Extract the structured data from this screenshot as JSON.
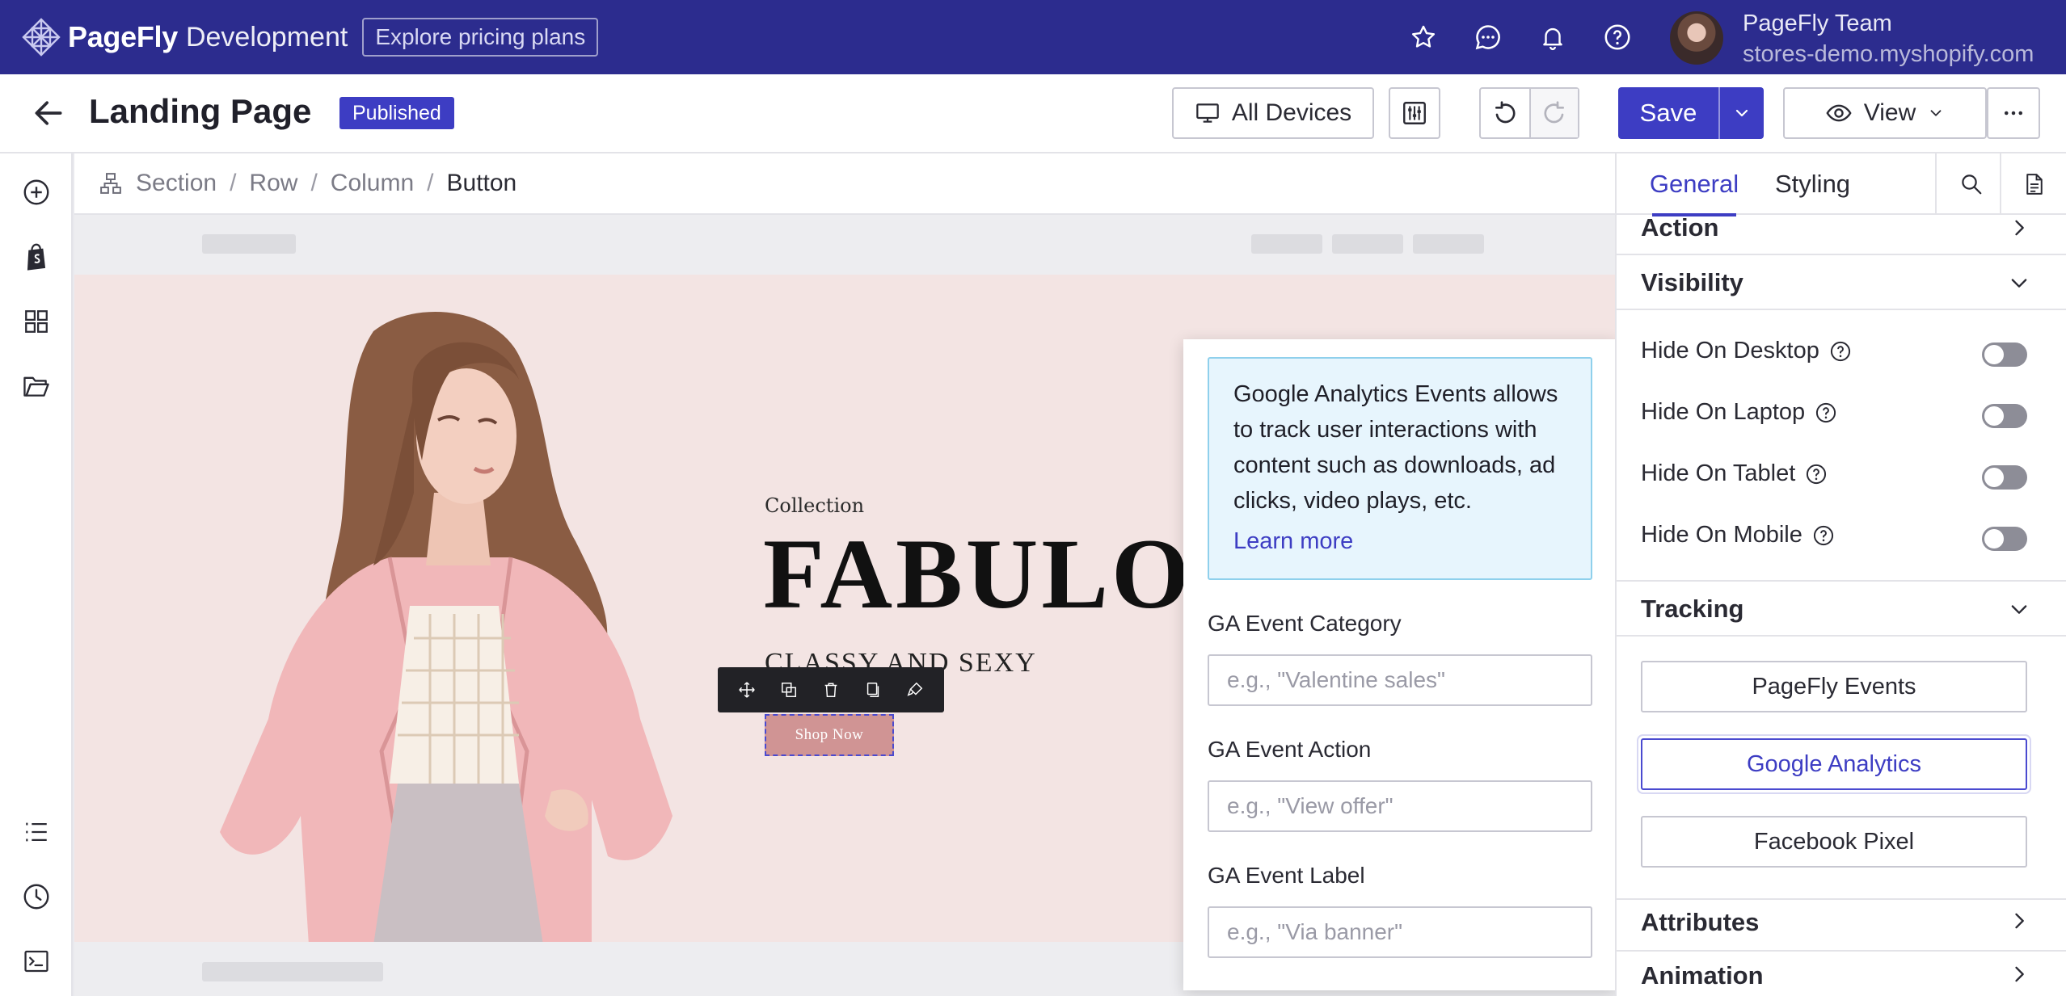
{
  "topbar": {
    "brand": "PageFly",
    "brand_sub": "Development",
    "pricing_label": "Explore pricing plans",
    "user_name": "PageFly Team",
    "user_store": "stores-demo.myshopify.com"
  },
  "page": {
    "title": "Landing Page",
    "status": "Published"
  },
  "toolbar": {
    "devices_label": "All Devices",
    "save_label": "Save",
    "view_label": "View"
  },
  "breadcrumb": [
    "Section",
    "Row",
    "Column",
    "Button"
  ],
  "canvas": {
    "collection": "Collection",
    "headline": "FABULO",
    "tagline": "CLASSY AND SEXY",
    "cta": "Shop Now"
  },
  "popup": {
    "info_text": "Google Analytics Events allows to track user interactions with content such as downloads, ad clicks, video plays, etc.",
    "learn_more": "Learn more",
    "fields": [
      {
        "label": "GA Event Category",
        "placeholder": "e.g., \"Valentine sales\""
      },
      {
        "label": "GA Event Action",
        "placeholder": "e.g., \"View offer\""
      },
      {
        "label": "GA Event Label",
        "placeholder": "e.g., \"Via banner\""
      }
    ]
  },
  "panel": {
    "tabs": [
      "General",
      "Styling"
    ],
    "active_tab": "General",
    "sections": {
      "action": "Action",
      "visibility": "Visibility",
      "tracking": "Tracking",
      "attributes": "Attributes",
      "animation": "Animation"
    },
    "visibility_toggles": [
      {
        "label": "Hide On Desktop",
        "on": false
      },
      {
        "label": "Hide On Laptop",
        "on": false
      },
      {
        "label": "Hide On Tablet",
        "on": false
      },
      {
        "label": "Hide On Mobile",
        "on": false
      }
    ],
    "tracking_buttons": [
      "PageFly Events",
      "Google Analytics",
      "Facebook Pixel"
    ],
    "active_tracking": "Google Analytics"
  },
  "colors": {
    "topbar": "#2c2c8e",
    "accent": "#3d3dc3",
    "info_bg": "#e7f5fd",
    "cta_bg": "#d09494"
  }
}
